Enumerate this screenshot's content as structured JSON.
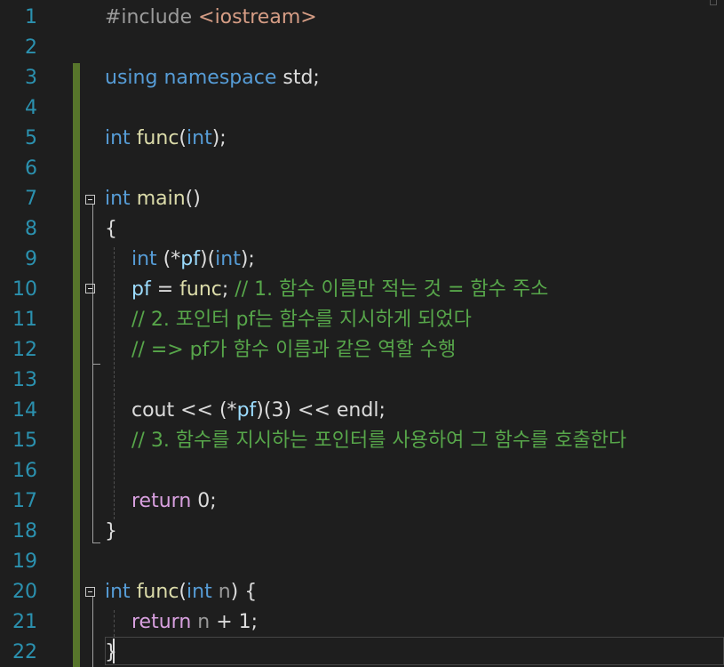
{
  "editor": {
    "line_numbers": [
      "1",
      "2",
      "3",
      "4",
      "5",
      "6",
      "7",
      "8",
      "9",
      "10",
      "11",
      "12",
      "13",
      "14",
      "15",
      "16",
      "17",
      "18",
      "19",
      "20",
      "21",
      "22"
    ],
    "code": {
      "l1": {
        "directive": "#include ",
        "header": "<iostream>"
      },
      "l3": {
        "kw_using": "using",
        "sp1": " ",
        "kw_namespace": "namespace",
        "rest": " std;"
      },
      "l5": {
        "kw_int": "int",
        "sp1": " ",
        "fn": "func",
        "open": "(",
        "kw_int2": "int",
        "close": ");"
      },
      "l7": {
        "kw_int": "int",
        "sp1": " ",
        "fn": "main",
        "parens": "()"
      },
      "l8": {
        "brace": "{"
      },
      "l9": {
        "kw_int": "int",
        "mid": " (*",
        "var": "pf",
        "mid2": ")(",
        "kw_int2": "int",
        "close": ");"
      },
      "l10": {
        "var": "pf",
        "mid": " = ",
        "fn": "func",
        "semi": "; ",
        "comment": "// 1. 함수 이름만 적는 것 = 함수 주소"
      },
      "l11": {
        "comment": "// 2. 포인터 pf는 함수를 지시하게 되었다"
      },
      "l12": {
        "comment": "// => pf가 함수 이름과 같은 역할 수행"
      },
      "l14": {
        "ident1": "cout",
        "op1": " << (*",
        "var": "pf",
        "mid": ")(3) << ",
        "ident2": "endl",
        "semi": ";"
      },
      "l15": {
        "comment": "// 3. 함수를 지시하는 포인터를 사용하여 그 함수를 호출한다"
      },
      "l17": {
        "kw_return": "return",
        "rest": " 0;"
      },
      "l18": {
        "brace": "}"
      },
      "l20": {
        "kw_int": "int",
        "sp1": " ",
        "fn": "func",
        "open": "(",
        "kw_int2": "int",
        "sp2": " ",
        "param": "n",
        "close": ") {"
      },
      "l21": {
        "kw_return": "return",
        "sp1": " ",
        "param": "n",
        "rest": " + 1;"
      },
      "l22": {
        "brace": "}"
      }
    }
  },
  "colors": {
    "background": "#1e1e1e",
    "line_number": "#2b91af",
    "keyword": "#569cd6",
    "control_keyword": "#d8a0df",
    "string": "#d69d85",
    "comment": "#57a64a",
    "function": "#dcdcaa",
    "variable": "#9cdcfe",
    "parameter": "#9a9a9a",
    "change_bar": "#57752b"
  },
  "icons": {
    "fold_main": "fold-collapse-icon",
    "fold_comment": "fold-collapse-icon",
    "fold_func": "fold-collapse-icon"
  }
}
